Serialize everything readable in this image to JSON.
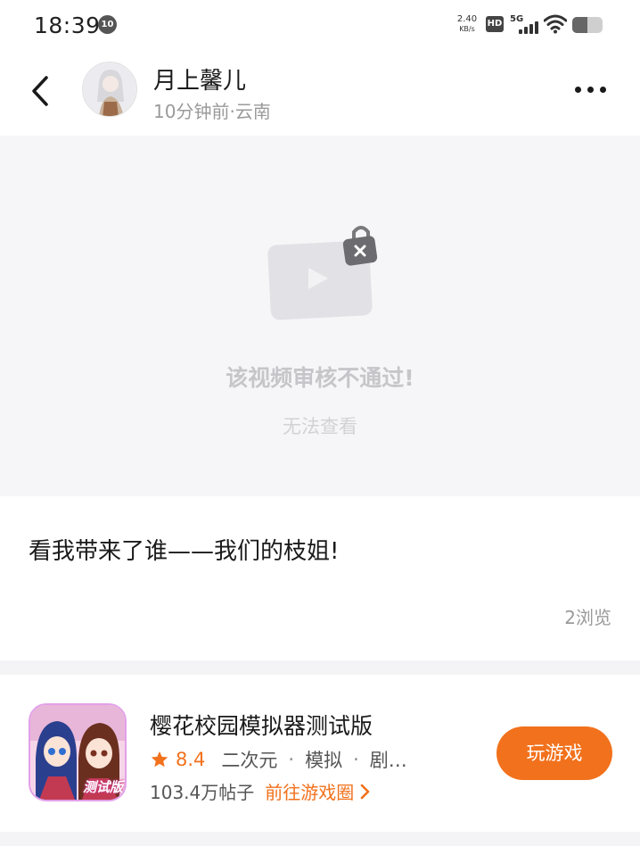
{
  "status_bar": {
    "time": "18:39",
    "notification_count": "10",
    "net_speed_value": "2.40",
    "net_speed_unit": "KB/s",
    "hd_label": "HD",
    "network_type": "5G",
    "battery_level": 0.5
  },
  "header": {
    "author_name": "月上馨儿",
    "post_meta": "10分钟前·云南"
  },
  "video": {
    "message": "该视频审核不通过!",
    "sub_message": "无法查看"
  },
  "post": {
    "text": "看我带来了谁——我们的枝姐!",
    "views": "2浏览"
  },
  "game": {
    "title": "樱花校园模拟器测试版",
    "rating": "8.4",
    "tags": [
      "二次元",
      "模拟",
      "剧…"
    ],
    "posts_count": "103.4万帖子",
    "go_to_circle": "前往游戏圈",
    "icon_badge": "测试版",
    "play_label": "玩游戏"
  },
  "colors": {
    "accent": "#f2711c",
    "rating": "#f2711c"
  },
  "icons": {
    "back": "chevron-left-icon",
    "more": "more-dots-icon",
    "video_locked": "locked-video-icon",
    "star": "star-icon",
    "wifi": "wifi-icon",
    "battery": "battery-icon"
  }
}
